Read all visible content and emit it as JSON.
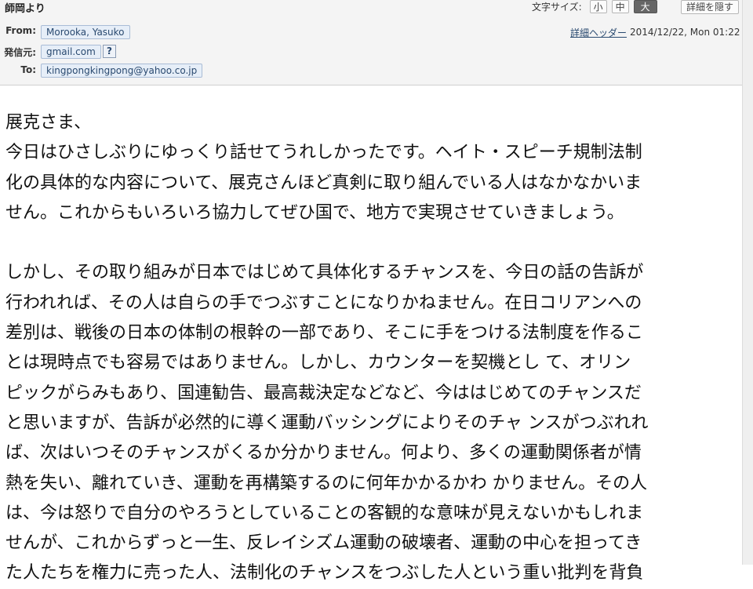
{
  "header": {
    "subject": "師岡より",
    "font_size": {
      "label": "文字サイズ:",
      "options": [
        "小",
        "中",
        "大"
      ],
      "selected": "大"
    },
    "hide_details_label": "詳細を隠す",
    "detail_header_link": "詳細ヘッダー",
    "date": "2014/12/22, Mon 01:22",
    "from_label": "From:",
    "from_value": "Morooka, Yasuko",
    "sender_label": "発信元:",
    "sender_value": "gmail.com",
    "help_icon_glyph": "?",
    "to_label": "To:",
    "to_value": "kingpongkingpong@yahoo.co.jp"
  },
  "body": {
    "lines": [
      "展克さま、",
      "今日はひさしぶりにゆっくり話せてうれしかったです。ヘイト・スピーチ規制法制",
      "化の具体的な内容について、展克さんほど真剣に取り組んでいる人はなかなかいま",
      "せん。これからもいろいろ協力してぜひ国で、地方で実現させていきましょう。",
      "しかし、その取り組みが日本ではじめて具体化するチャンスを、今日の話の告訴が",
      "行われれば、その人は自らの手でつぶすことになりかねません。在日コリアンへの",
      "差別は、戦後の日本の体制の根幹の一部であり、そこに手をつける法制度を作るこ",
      "とは現時点でも容易ではありません。しかし、カウンターを契機とし て、オリン",
      "ピックがらみもあり、国連勧告、最高裁決定などなど、今ははじめてのチャンスだ",
      "と思いますが、告訴が必然的に導く運動バッシングによりそのチャ ンスがつぶれれ",
      "ば、次はいつそのチャンスがくるか分かりません。何より、多くの運動関係者が情",
      "熱を失い、離れていき、運動を再構築するのに何年かかるかわ かりません。その人",
      "は、今は怒りで自分のやろうとしていることの客観的な意味が見えないかもしれま",
      "せんが、これからずっと一生、反レイシズム運動の破壊者、運動の中心を担ってき",
      "た人たちを権力に売った人、法制化のチャンスをつぶした人という重い批判を背負"
    ]
  }
}
